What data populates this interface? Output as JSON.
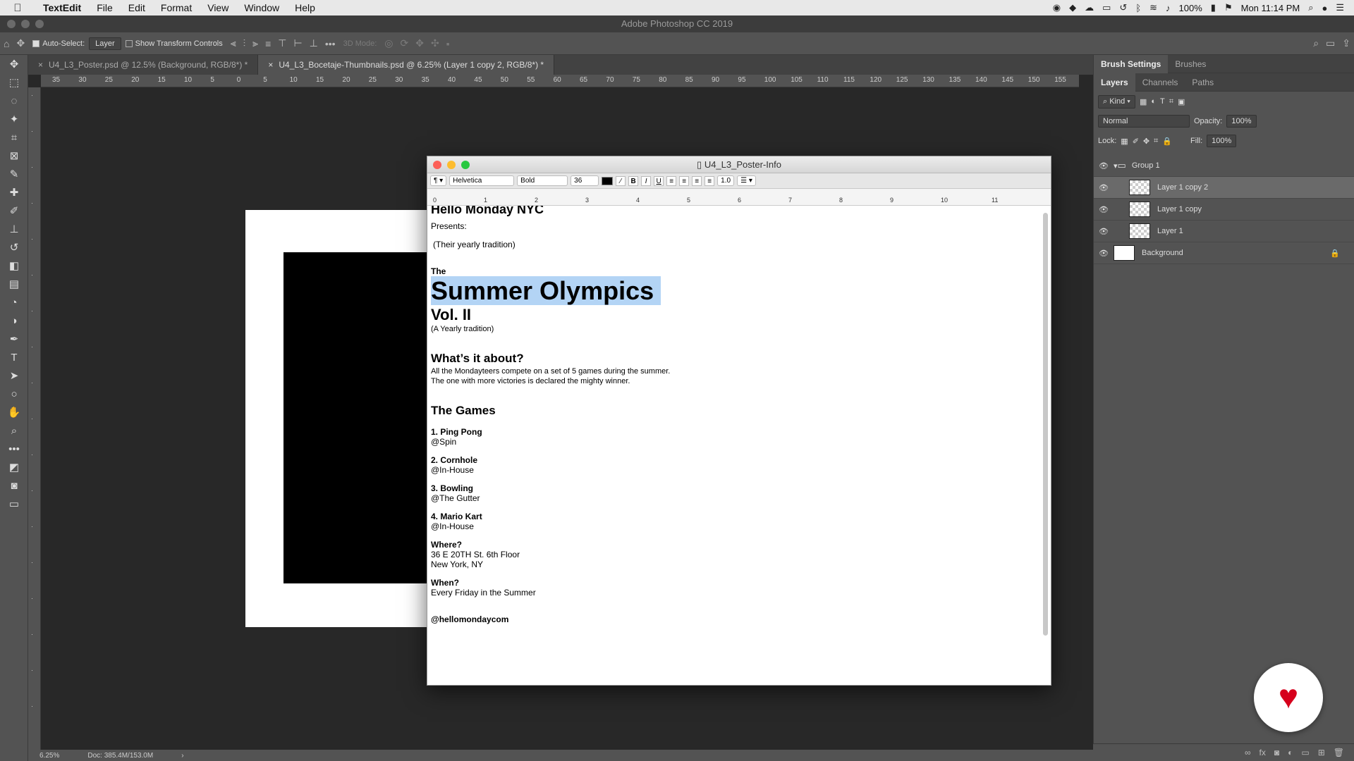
{
  "menubar": {
    "app": "TextEdit",
    "items": [
      "File",
      "Edit",
      "Format",
      "View",
      "Window",
      "Help"
    ],
    "battery": "100%",
    "clock": "Mon 11:14 PM"
  },
  "ps": {
    "title": "Adobe Photoshop CC 2019"
  },
  "options": {
    "auto_select": "Auto-Select:",
    "layer_select": "Layer",
    "transform": "Show Transform Controls",
    "mode3d": "3D Mode:"
  },
  "tabs": [
    {
      "label": "U4_L3_Poster.psd @ 12.5% (Background, RGB/8*) *"
    },
    {
      "label": "U4_L3_Bocetaje-Thumbnails.psd @ 6.25% (Layer 1 copy 2, RGB/8*) *"
    }
  ],
  "ruler_h": [
    "35",
    "30",
    "25",
    "20",
    "15",
    "10",
    "5",
    "0",
    "5",
    "10",
    "15",
    "20",
    "25",
    "30",
    "35",
    "40",
    "45",
    "50",
    "55",
    "60",
    "65",
    "70",
    "75",
    "80",
    "85",
    "90",
    "95",
    "100",
    "105",
    "110",
    "115",
    "120",
    "125",
    "130",
    "135",
    "140",
    "145",
    "150",
    "155"
  ],
  "status": {
    "zoom": "6.25%",
    "doc": "Doc: 385.4M/153.0M"
  },
  "panels": {
    "top_tabs": [
      "Brush Settings",
      "Brushes"
    ],
    "layer_tabs": [
      "Layers",
      "Channels",
      "Paths"
    ],
    "kind": "Kind",
    "blend": "Normal",
    "opacity_label": "Opacity:",
    "opacity": "100%",
    "lock_label": "Lock:",
    "fill_label": "Fill:",
    "fill": "100%"
  },
  "layers": [
    {
      "name": "Group 1"
    },
    {
      "name": "Layer 1 copy 2"
    },
    {
      "name": "Layer 1 copy"
    },
    {
      "name": "Layer 1"
    },
    {
      "name": "Background"
    }
  ],
  "textedit": {
    "title": "U4_L3_Poster-Info",
    "font": "Helvetica",
    "weight": "Bold",
    "size": "36",
    "spacing": "1.0",
    "ruler": [
      "0",
      "1",
      "2",
      "3",
      "4",
      "5",
      "6",
      "7",
      "8",
      "9",
      "10",
      "11"
    ],
    "doc": {
      "l1": "Hello Monday NYC",
      "l2": "Presents:",
      "l3": "(Their yearly tradition)",
      "l4": "The",
      "l5": "Summer Olympics",
      "l6": "Vol. II",
      "l7": "(A Yearly tradition)",
      "l8": "What’s it about?",
      "l9": "All the Mondayteers compete on a set of 5 games during the summer.",
      "l10": "The one with more victories is declared the mighty winner.",
      "l11": "The Games",
      "g1": "1. Ping Pong",
      "g1v": "@Spin",
      "g2": "2. Cornhole",
      "g2v": "@In-House",
      "g3": "3. Bowling",
      "g3v": "@The Gutter",
      "g4": "4. Mario Kart",
      "g4v": "@In-House",
      "where": "Where?",
      "addr1": "36 E 20TH St. 6th Floor",
      "addr2": "New York, NY",
      "when": "When?",
      "when1": "Every Friday in the Summer",
      "handle": "@hellomondaycom"
    }
  }
}
